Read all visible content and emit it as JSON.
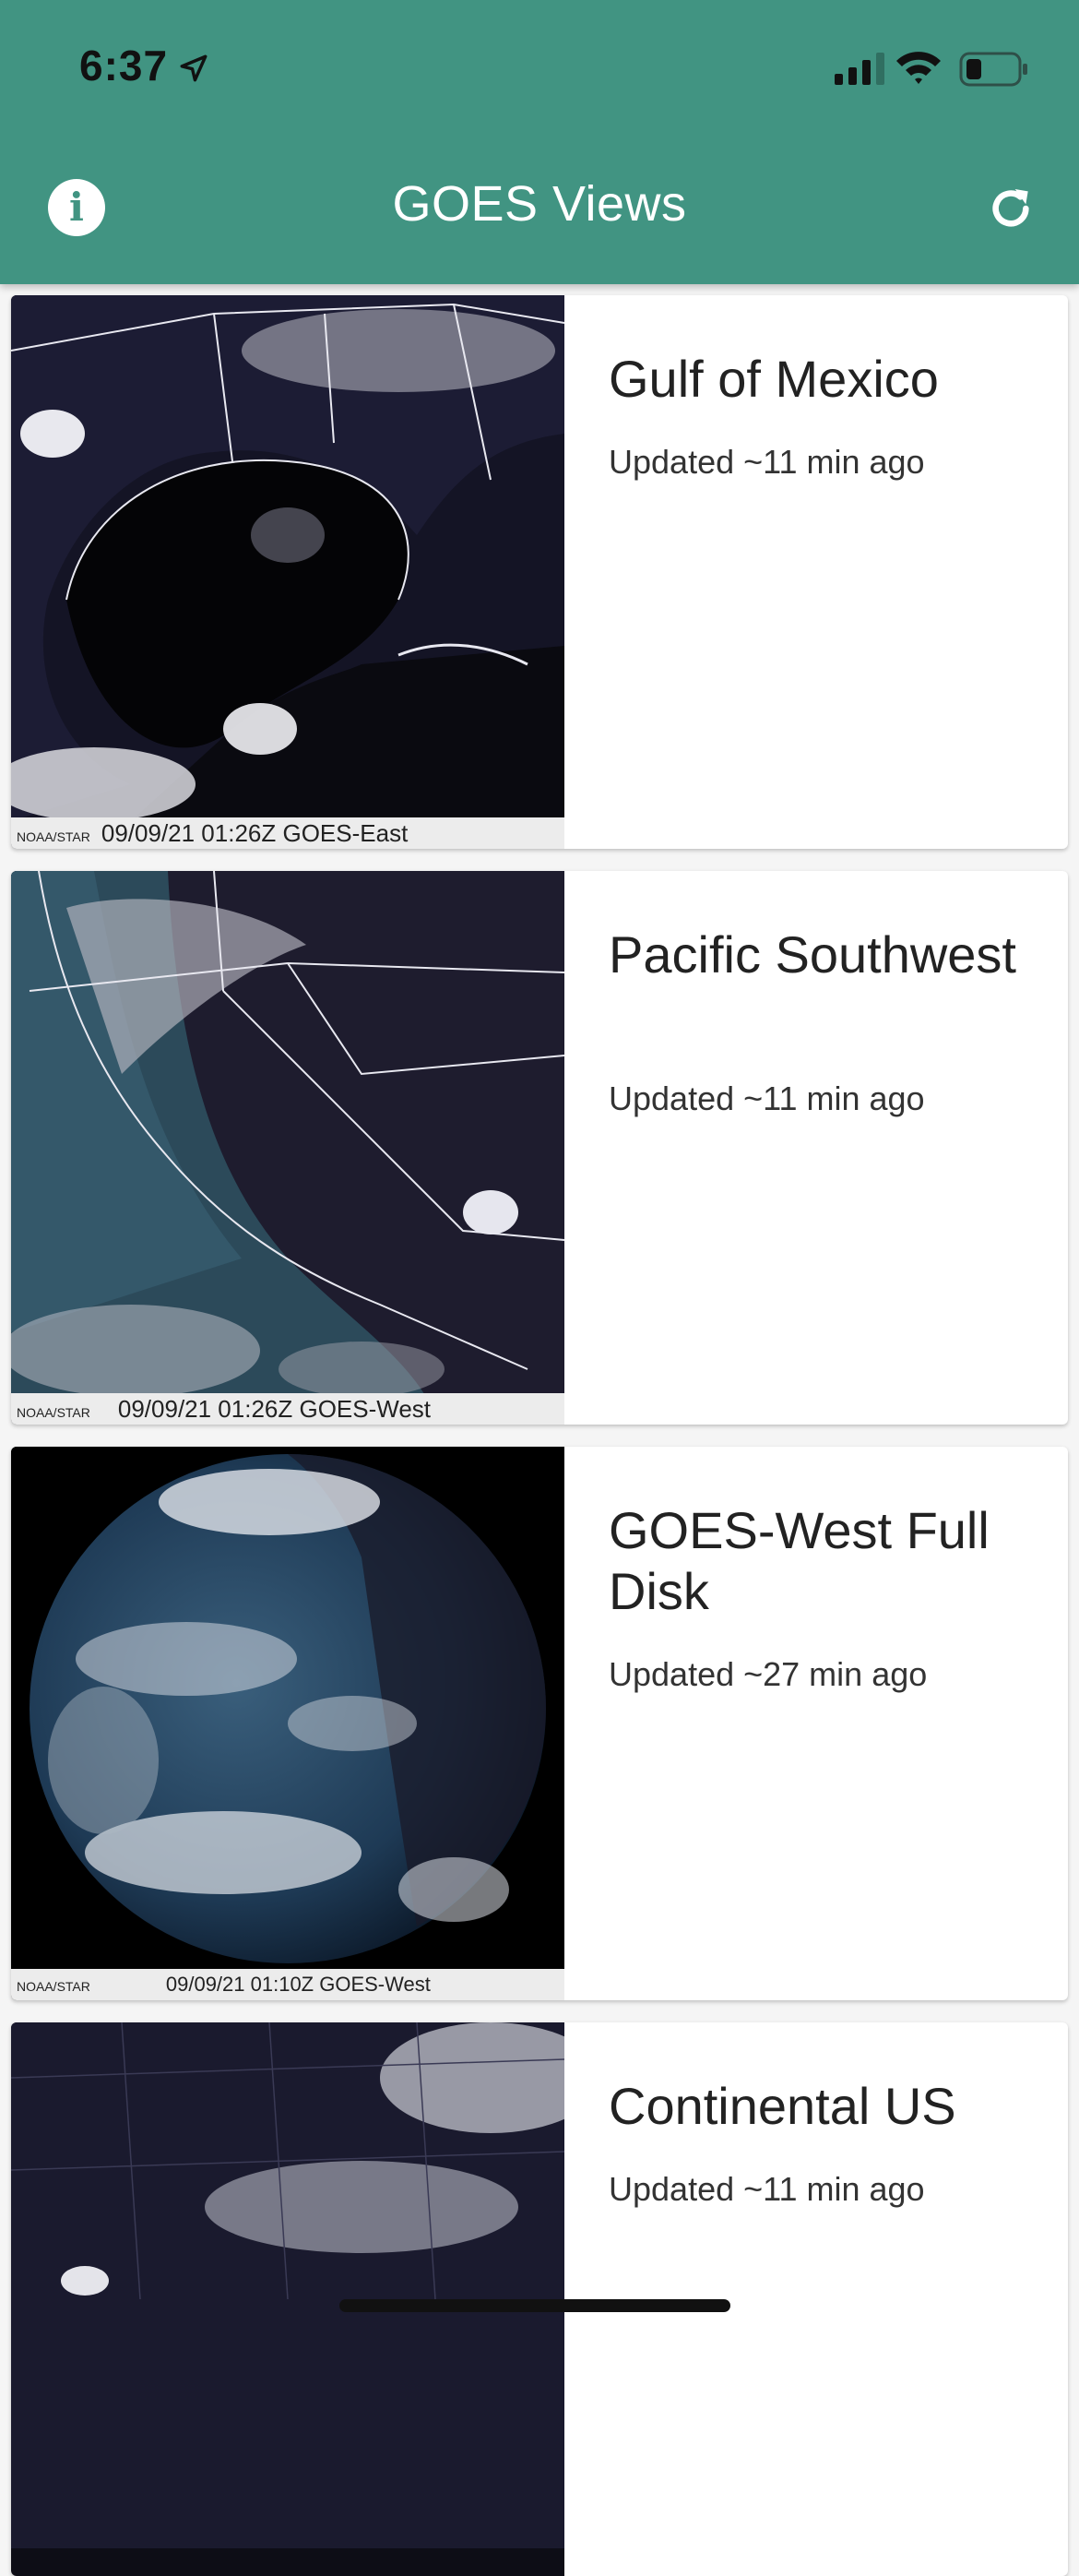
{
  "status_bar": {
    "time": "6:37"
  },
  "header": {
    "title": "GOES Views",
    "info_icon": "info-icon",
    "refresh_icon": "refresh-icon",
    "background": "#419482"
  },
  "cards": [
    {
      "title": "Gulf of Mexico",
      "updated": "Updated ~11 min ago",
      "caption_source": "NOAA/STAR",
      "caption": "09/09/21 01:26Z GOES-East"
    },
    {
      "title": "Pacific Southwest",
      "updated": "Updated ~11 min ago",
      "caption_source": "NOAA/STAR",
      "caption": "09/09/21 01:26Z GOES-West"
    },
    {
      "title": "GOES-West Full Disk",
      "updated": "Updated ~27 min ago",
      "caption_source": "NOAA/STAR",
      "caption": "09/09/21 01:10Z GOES-West"
    },
    {
      "title": "Continental US",
      "updated": "Updated ~11 min ago"
    }
  ]
}
